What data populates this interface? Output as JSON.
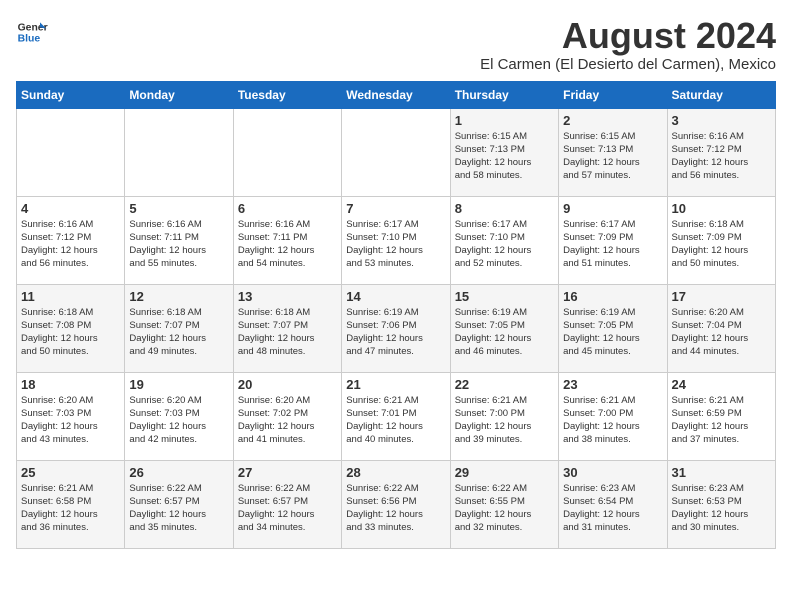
{
  "logo": {
    "line1": "General",
    "line2": "Blue"
  },
  "title": "August 2024",
  "subtitle": "El Carmen (El Desierto del Carmen), Mexico",
  "header": {
    "days": [
      "Sunday",
      "Monday",
      "Tuesday",
      "Wednesday",
      "Thursday",
      "Friday",
      "Saturday"
    ]
  },
  "weeks": [
    [
      {
        "day": "",
        "info": ""
      },
      {
        "day": "",
        "info": ""
      },
      {
        "day": "",
        "info": ""
      },
      {
        "day": "",
        "info": ""
      },
      {
        "day": "1",
        "info": "Sunrise: 6:15 AM\nSunset: 7:13 PM\nDaylight: 12 hours\nand 58 minutes."
      },
      {
        "day": "2",
        "info": "Sunrise: 6:15 AM\nSunset: 7:13 PM\nDaylight: 12 hours\nand 57 minutes."
      },
      {
        "day": "3",
        "info": "Sunrise: 6:16 AM\nSunset: 7:12 PM\nDaylight: 12 hours\nand 56 minutes."
      }
    ],
    [
      {
        "day": "4",
        "info": "Sunrise: 6:16 AM\nSunset: 7:12 PM\nDaylight: 12 hours\nand 56 minutes."
      },
      {
        "day": "5",
        "info": "Sunrise: 6:16 AM\nSunset: 7:11 PM\nDaylight: 12 hours\nand 55 minutes."
      },
      {
        "day": "6",
        "info": "Sunrise: 6:16 AM\nSunset: 7:11 PM\nDaylight: 12 hours\nand 54 minutes."
      },
      {
        "day": "7",
        "info": "Sunrise: 6:17 AM\nSunset: 7:10 PM\nDaylight: 12 hours\nand 53 minutes."
      },
      {
        "day": "8",
        "info": "Sunrise: 6:17 AM\nSunset: 7:10 PM\nDaylight: 12 hours\nand 52 minutes."
      },
      {
        "day": "9",
        "info": "Sunrise: 6:17 AM\nSunset: 7:09 PM\nDaylight: 12 hours\nand 51 minutes."
      },
      {
        "day": "10",
        "info": "Sunrise: 6:18 AM\nSunset: 7:09 PM\nDaylight: 12 hours\nand 50 minutes."
      }
    ],
    [
      {
        "day": "11",
        "info": "Sunrise: 6:18 AM\nSunset: 7:08 PM\nDaylight: 12 hours\nand 50 minutes."
      },
      {
        "day": "12",
        "info": "Sunrise: 6:18 AM\nSunset: 7:07 PM\nDaylight: 12 hours\nand 49 minutes."
      },
      {
        "day": "13",
        "info": "Sunrise: 6:18 AM\nSunset: 7:07 PM\nDaylight: 12 hours\nand 48 minutes."
      },
      {
        "day": "14",
        "info": "Sunrise: 6:19 AM\nSunset: 7:06 PM\nDaylight: 12 hours\nand 47 minutes."
      },
      {
        "day": "15",
        "info": "Sunrise: 6:19 AM\nSunset: 7:05 PM\nDaylight: 12 hours\nand 46 minutes."
      },
      {
        "day": "16",
        "info": "Sunrise: 6:19 AM\nSunset: 7:05 PM\nDaylight: 12 hours\nand 45 minutes."
      },
      {
        "day": "17",
        "info": "Sunrise: 6:20 AM\nSunset: 7:04 PM\nDaylight: 12 hours\nand 44 minutes."
      }
    ],
    [
      {
        "day": "18",
        "info": "Sunrise: 6:20 AM\nSunset: 7:03 PM\nDaylight: 12 hours\nand 43 minutes."
      },
      {
        "day": "19",
        "info": "Sunrise: 6:20 AM\nSunset: 7:03 PM\nDaylight: 12 hours\nand 42 minutes."
      },
      {
        "day": "20",
        "info": "Sunrise: 6:20 AM\nSunset: 7:02 PM\nDaylight: 12 hours\nand 41 minutes."
      },
      {
        "day": "21",
        "info": "Sunrise: 6:21 AM\nSunset: 7:01 PM\nDaylight: 12 hours\nand 40 minutes."
      },
      {
        "day": "22",
        "info": "Sunrise: 6:21 AM\nSunset: 7:00 PM\nDaylight: 12 hours\nand 39 minutes."
      },
      {
        "day": "23",
        "info": "Sunrise: 6:21 AM\nSunset: 7:00 PM\nDaylight: 12 hours\nand 38 minutes."
      },
      {
        "day": "24",
        "info": "Sunrise: 6:21 AM\nSunset: 6:59 PM\nDaylight: 12 hours\nand 37 minutes."
      }
    ],
    [
      {
        "day": "25",
        "info": "Sunrise: 6:21 AM\nSunset: 6:58 PM\nDaylight: 12 hours\nand 36 minutes."
      },
      {
        "day": "26",
        "info": "Sunrise: 6:22 AM\nSunset: 6:57 PM\nDaylight: 12 hours\nand 35 minutes."
      },
      {
        "day": "27",
        "info": "Sunrise: 6:22 AM\nSunset: 6:57 PM\nDaylight: 12 hours\nand 34 minutes."
      },
      {
        "day": "28",
        "info": "Sunrise: 6:22 AM\nSunset: 6:56 PM\nDaylight: 12 hours\nand 33 minutes."
      },
      {
        "day": "29",
        "info": "Sunrise: 6:22 AM\nSunset: 6:55 PM\nDaylight: 12 hours\nand 32 minutes."
      },
      {
        "day": "30",
        "info": "Sunrise: 6:23 AM\nSunset: 6:54 PM\nDaylight: 12 hours\nand 31 minutes."
      },
      {
        "day": "31",
        "info": "Sunrise: 6:23 AM\nSunset: 6:53 PM\nDaylight: 12 hours\nand 30 minutes."
      }
    ]
  ]
}
